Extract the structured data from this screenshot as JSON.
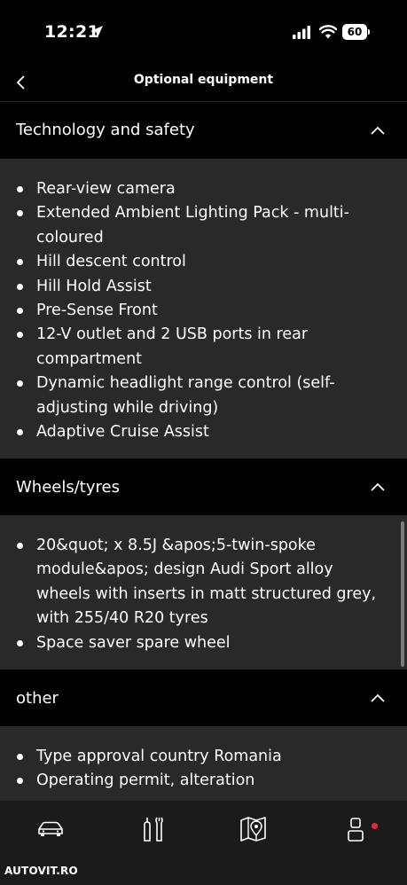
{
  "status_bar": {
    "time": "12:21",
    "battery": "60"
  },
  "nav": {
    "title": "Optional equipment"
  },
  "sections": [
    {
      "title": "Technology and safety",
      "items": [
        "Rear-view camera",
        "Extended Ambient Lighting Pack - multi-coloured",
        "Hill descent control",
        "Hill Hold Assist",
        "Pre-Sense Front",
        "12-V outlet and 2 USB ports in rear compartment",
        "Dynamic headlight range control (self-adjusting while driving)",
        "Adaptive Cruise Assist"
      ]
    },
    {
      "title": "Wheels/tyres",
      "items": [
        "20&quot; x 8.5J &apos;5-twin-spoke module&apos; design Audi Sport alloy wheels with inserts in matt structured grey, with 255/40 R20 tyres",
        "Space saver spare wheel"
      ]
    },
    {
      "title": "other",
      "items": [
        "Type approval country Romania",
        "Operating permit, alteration"
      ]
    }
  ],
  "tabs": [
    "car-icon",
    "tools-icon",
    "map-icon",
    "profile-icon"
  ],
  "watermark": "AUTOVIT.RO",
  "colors": {
    "background": "#000000",
    "section_body": "#292929",
    "bottom_bar": "#1b1b1b",
    "notification": "#e8273a"
  }
}
